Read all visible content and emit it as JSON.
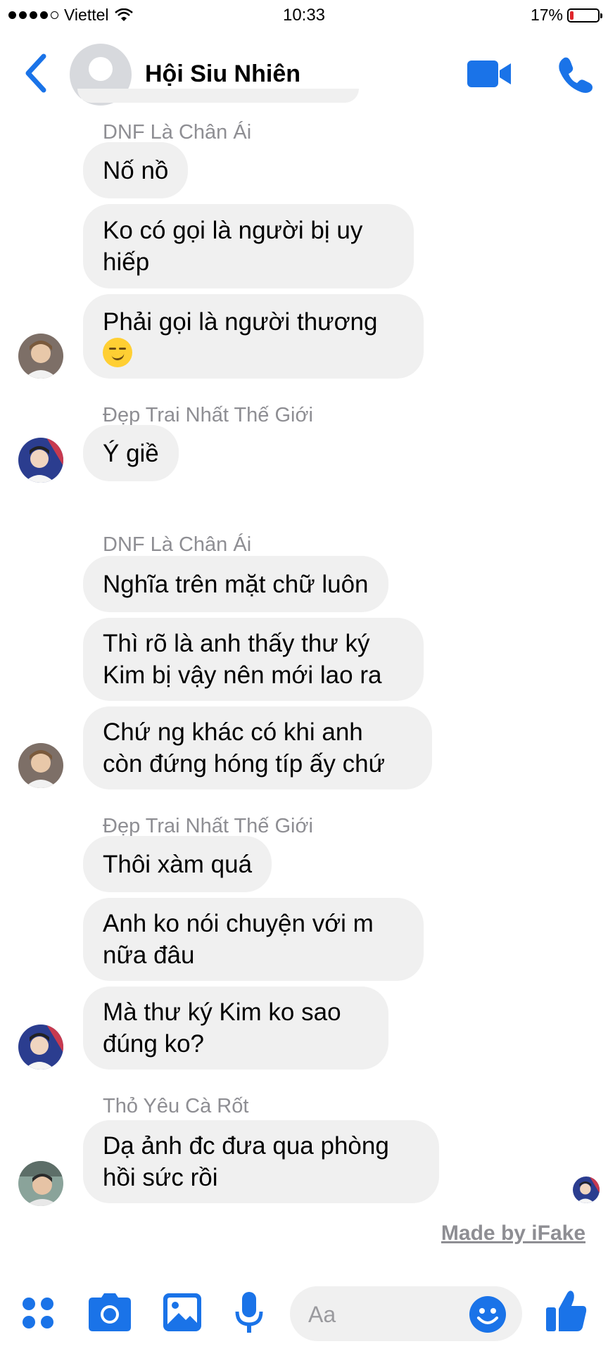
{
  "status_bar": {
    "carrier": "Viettel",
    "time": "10:33",
    "battery": "17%",
    "battery_level": 0.17
  },
  "header": {
    "title": "Hội Siu Nhiên"
  },
  "messages": [
    {
      "sender": "DNF Là Chân Ái",
      "bubbles": [
        "Nố nồ",
        "Ko có gọi là người bị uy\nhiếp",
        "Phải gọi là người thương"
      ],
      "emoji": "smirking-face"
    },
    {
      "sender": "Đẹp Trai Nhất Thế Giới",
      "bubbles": [
        "Ý giề"
      ]
    },
    {
      "sender": "DNF Là Chân Ái",
      "bubbles": [
        "Nghĩa trên mặt chữ luôn",
        "Thì rõ là anh thấy thư ký\nKim bị vậy nên mới lao ra",
        "Chứ ng khác có khi anh\ncòn đứng hóng típ ấy chứ"
      ]
    },
    {
      "sender": "Đẹp Trai Nhất Thế Giới",
      "bubbles": [
        "Thôi xàm quá",
        "Anh ko nói chuyện với m\nnữa đâu",
        "Mà thư ký Kim ko sao\nđúng ko?"
      ]
    },
    {
      "sender": "Thỏ Yêu Cà Rốt",
      "bubbles": [
        "Dạ ảnh đc đưa qua phòng\nhồi sức rồi"
      ]
    }
  ],
  "footer_note": "Made by iFake",
  "composer": {
    "placeholder": "Aa"
  },
  "colors": {
    "accent": "#1a73e8",
    "bubble": "#f0f0f0",
    "sender_name": "#8e8e93"
  }
}
